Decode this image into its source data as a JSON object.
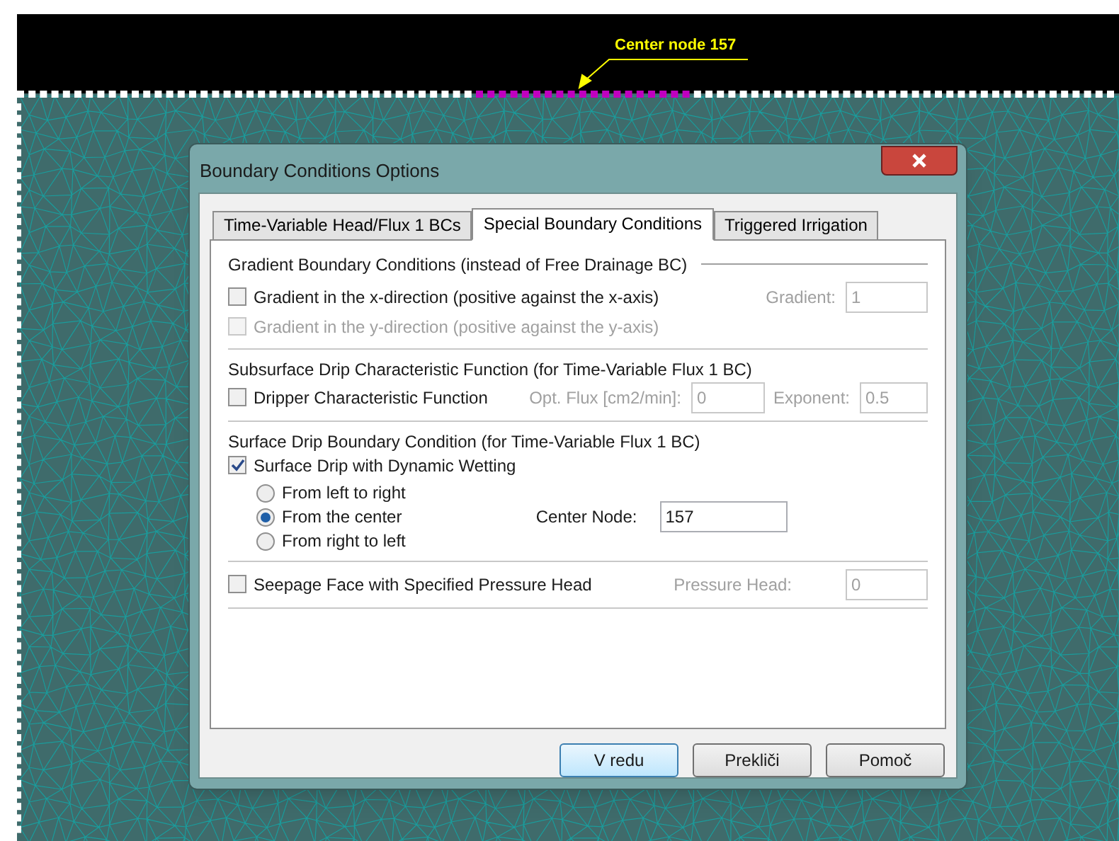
{
  "canvas": {
    "annotation": {
      "label": "Center node 157"
    }
  },
  "dialog": {
    "title": "Boundary Conditions Options",
    "tabs": [
      {
        "label": "Time-Variable Head/Flux 1 BCs",
        "selected": false
      },
      {
        "label": "Special Boundary Conditions",
        "selected": true
      },
      {
        "label": "Triggered Irrigation",
        "selected": false
      }
    ],
    "gradient": {
      "title": "Gradient Boundary Conditions (instead of Free Drainage BC)",
      "checkboxes": [
        {
          "label": "Gradient in the x-direction (positive against the x-axis)",
          "checked": false,
          "disabled": false
        },
        {
          "label": "Gradient in the y-direction (positive against the y-axis)",
          "checked": false,
          "disabled": true
        }
      ],
      "field": {
        "label": "Gradient:",
        "value": "1",
        "disabled": true
      }
    },
    "subsurface_drip": {
      "title": "Subsurface Drip Characteristic Function (for Time-Variable Flux 1 BC)",
      "checkbox": {
        "label": "Dripper Characteristic Function",
        "checked": false,
        "disabled": false
      },
      "fields": [
        {
          "label": "Opt. Flux [cm2/min]:",
          "value": "0",
          "disabled": true
        },
        {
          "label": "Exponent:",
          "value": "0.5",
          "disabled": true
        }
      ]
    },
    "surface_drip": {
      "title": "Surface Drip Boundary Condition (for Time-Variable Flux 1 BC)",
      "checkbox": {
        "label": "Surface Drip with Dynamic Wetting",
        "checked": true,
        "disabled": false
      },
      "radios": [
        {
          "label": "From left to right",
          "selected": false
        },
        {
          "label": "From the center",
          "selected": true
        },
        {
          "label": "From right to left",
          "selected": false
        }
      ],
      "field": {
        "label": "Center Node:",
        "value": "157",
        "disabled": false
      }
    },
    "seepage": {
      "checkbox": {
        "label": "Seepage Face with Specified Pressure Head",
        "checked": false,
        "disabled": false
      },
      "field": {
        "label": "Pressure Head:",
        "value": "0",
        "disabled": true
      }
    },
    "buttons": [
      {
        "label": "V redu",
        "default": true
      },
      {
        "label": "Prekliči",
        "default": false
      },
      {
        "label": "Pomoč",
        "default": false
      }
    ]
  }
}
